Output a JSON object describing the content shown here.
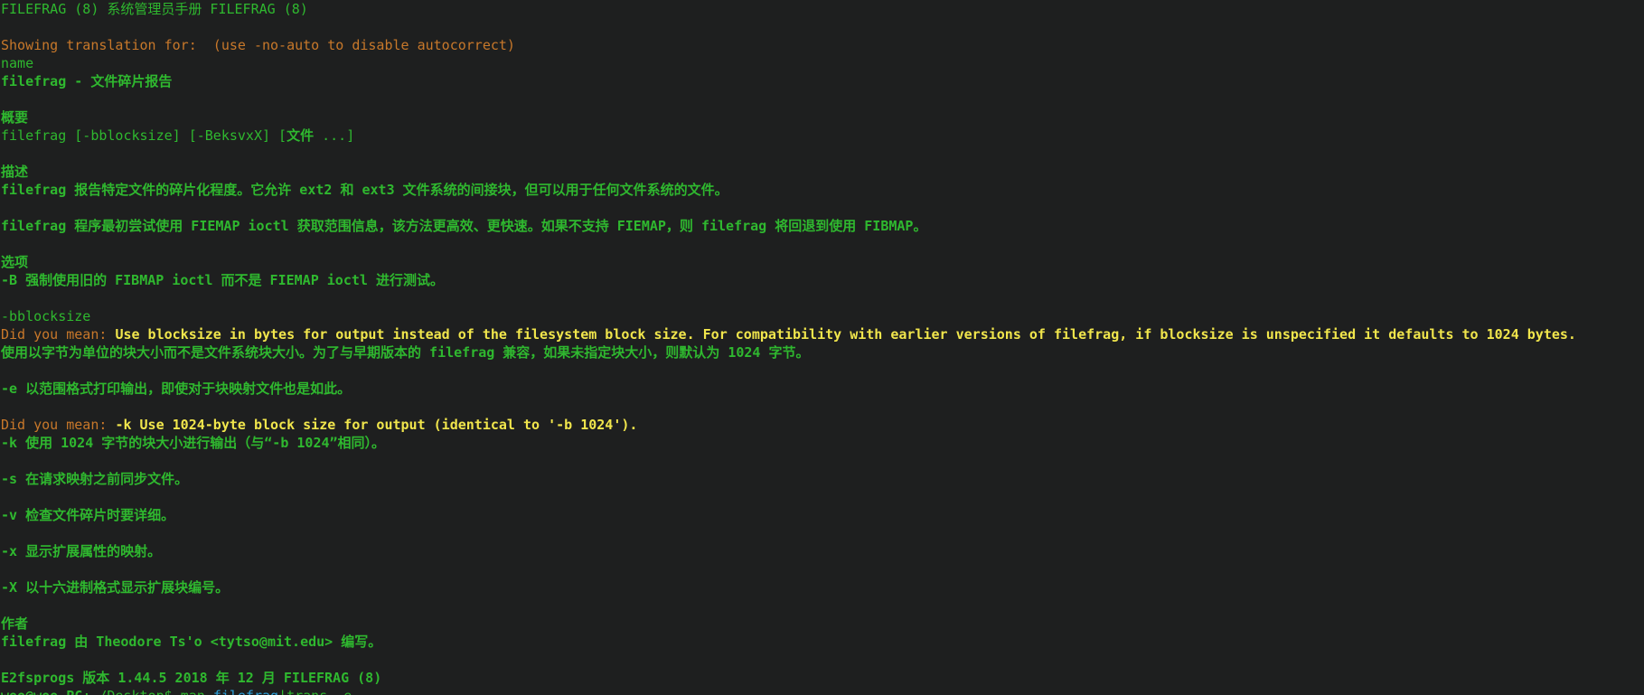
{
  "header": "FILEFRAG (8) 系统管理员手册 FILEFRAG (8)",
  "translation_note": "Showing translation for:  (use -no-auto to disable autocorrect)",
  "name_heading": "name",
  "name_line": "filefrag - 文件碎片报告",
  "synopsis_heading": "概要",
  "synopsis_line_a": "filefrag [-bblocksize] [-BeksvxX] [",
  "synopsis_line_b": "文件",
  "synopsis_line_c": " ...]",
  "description_heading": "描述",
  "description_p1": "filefrag 报告特定文件的碎片化程度。它允许 ext2 和 ext3 文件系统的间接块，但可以用于任何文件系统的文件。",
  "description_p2": "filefrag 程序最初尝试使用 FIEMAP ioctl 获取范围信息，该方法更高效、更快速。如果不支持 FIEMAP，则 filefrag 将回退到使用 FIBMAP。",
  "options_heading": "选项",
  "opt_B": "-B 强制使用旧的 FIBMAP ioctl 而不是 FIEMAP ioctl 进行测试。",
  "opt_b_flag": "-bblocksize",
  "did_you_mean_label": "Did you mean: ",
  "did_you_mean_1": "Use blocksize in bytes for output instead of the filesystem block size. For compatibility with earlier versions of filefrag, if blocksize is unspecified it defaults to 1024 bytes.",
  "opt_b_translation": "使用以字节为单位的块大小而不是文件系统块大小。为了与早期版本的 filefrag 兼容，如果未指定块大小，则默认为 1024 字节。",
  "opt_e": "-e 以范围格式打印输出，即使对于块映射文件也是如此。",
  "did_you_mean_label_2": "Did you mean: ",
  "did_you_mean_2": "-k Use 1024-byte block size for output (identical to '-b 1024').",
  "opt_k": "-k 使用 1024 字节的块大小进行输出（与“-b 1024”相同）。",
  "opt_s": "-s 在请求映射之前同步文件。",
  "opt_v": "-v 检查文件碎片时要详细。",
  "opt_x": "-x 显示扩展属性的映射。",
  "opt_X": "-X 以十六进制格式显示扩展块编号。",
  "author_heading": "作者",
  "author_line": "filefrag 由 Theodore Ts'o <tytso@mit.edu> 编写。",
  "footer": "E2fsprogs 版本 1.44.5 2018 年 12 月 FILEFRAG (8)",
  "prompt": {
    "user_host": "woo@woo-PC",
    "path": ":~/Desktop$ ",
    "command": "man",
    "arg": "filefrag",
    "pipe": "|",
    "rest": "trans -e ",
    "trailing": "-"
  },
  "colors": {
    "background": "#1e1f1f",
    "text_green": "#2fb82f",
    "text_orange": "#c8782a",
    "text_yellow": "#f1e64c",
    "text_cyan": "#2b9fd8"
  }
}
